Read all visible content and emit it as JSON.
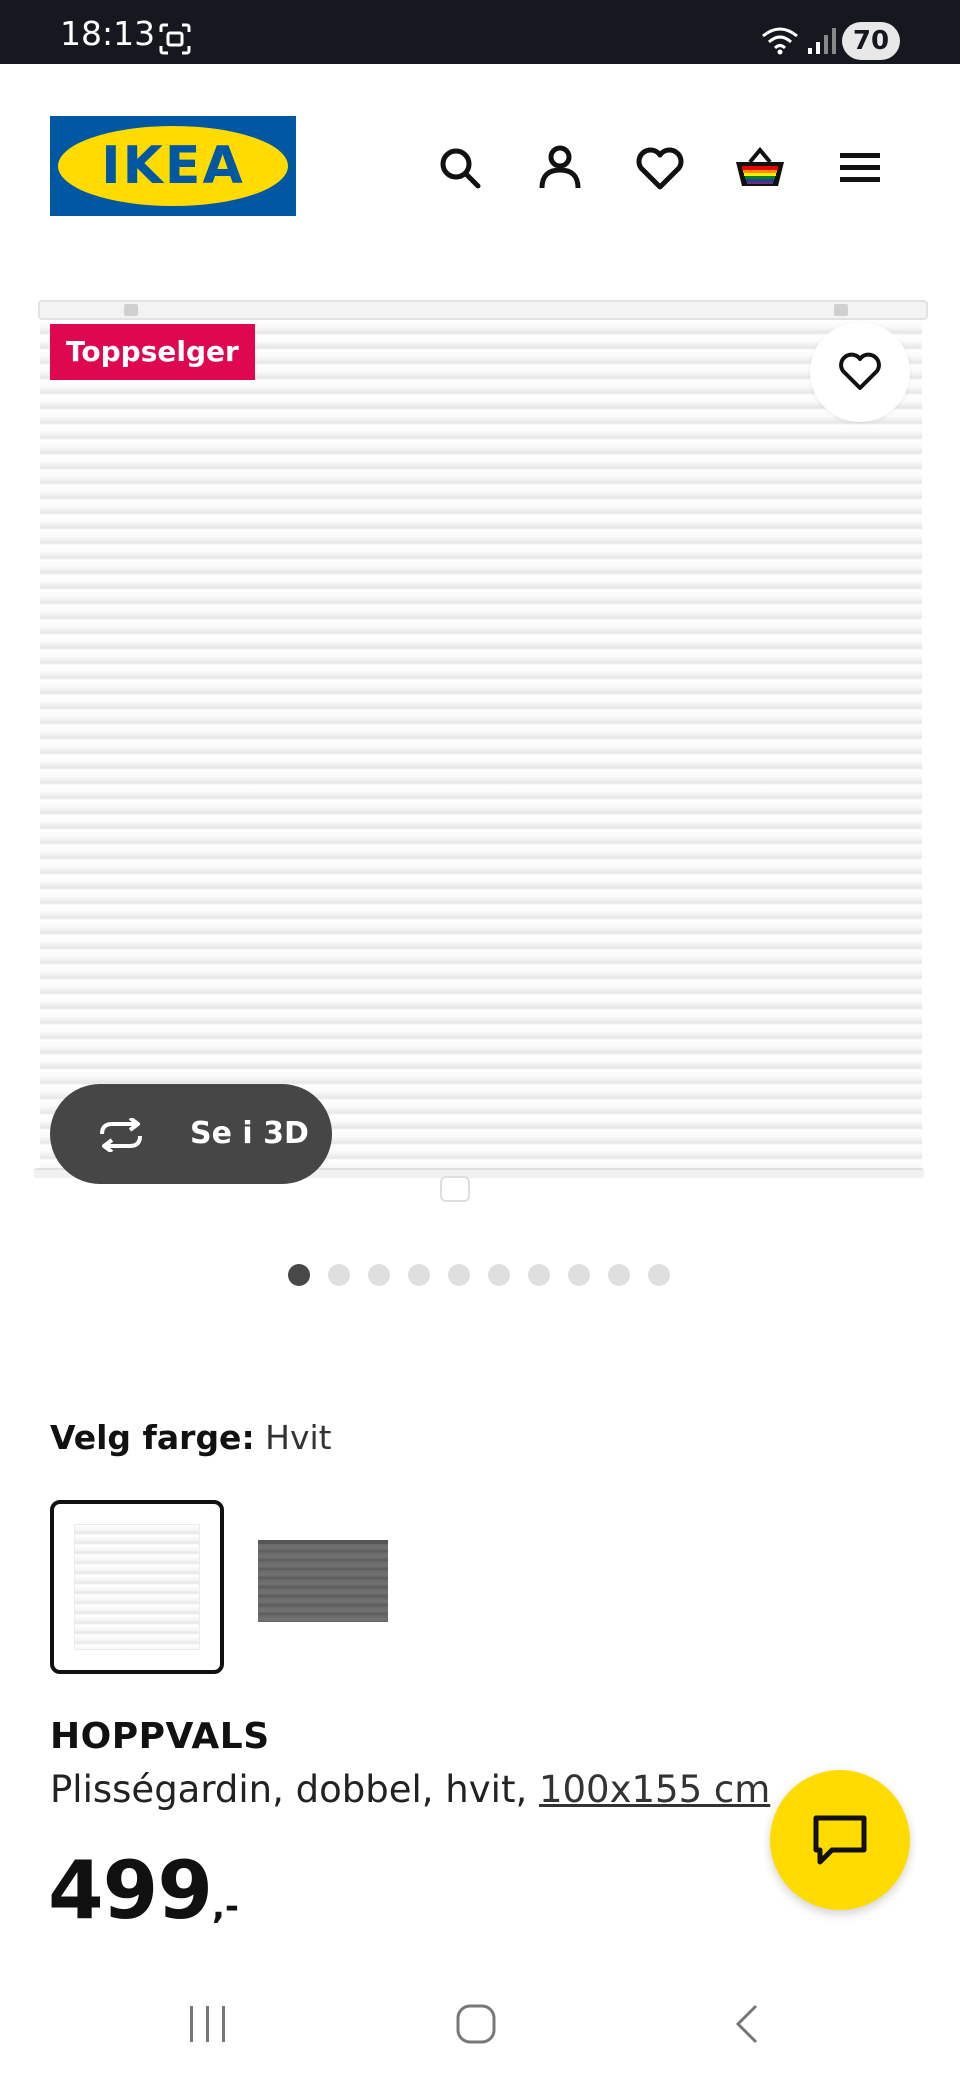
{
  "status_bar": {
    "time": "18:13",
    "battery": "70"
  },
  "header": {
    "logo_text": "IKEA",
    "icons": [
      "search-icon",
      "account-icon",
      "heart-icon",
      "basket-icon",
      "menu-icon"
    ]
  },
  "gallery": {
    "badge": "Toppselger",
    "view_3d_label": "Se i 3D",
    "dots_count": 10,
    "active_dot": 0
  },
  "color": {
    "label": "Velg farge:",
    "value": "Hvit",
    "options": [
      "white",
      "grey"
    ],
    "selected": "white"
  },
  "product": {
    "name": "HOPPVALS",
    "description": "Plisségardin, dobbel, hvit, ",
    "size": "100x155 cm",
    "price": "499",
    "price_suffix": ",-"
  },
  "colors": {
    "badge": "#e00751",
    "chat": "#ffdb00",
    "logo_blue": "#0058a3",
    "logo_yellow": "#ffdb00"
  }
}
